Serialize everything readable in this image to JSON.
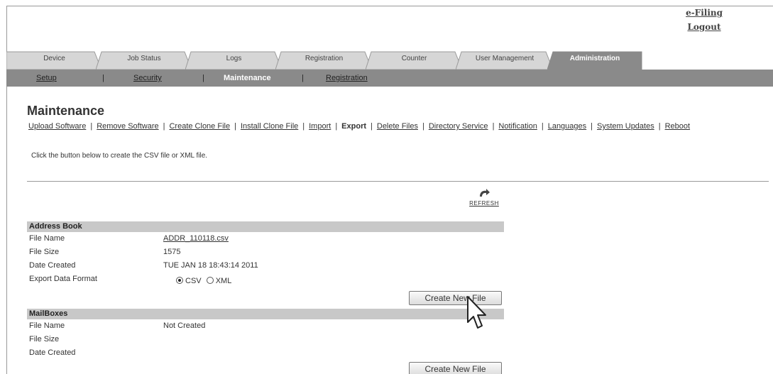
{
  "header": {
    "links": [
      "e-Filing",
      "Logout"
    ]
  },
  "tabs": [
    {
      "label": "Device",
      "active": false
    },
    {
      "label": "Job Status",
      "active": false
    },
    {
      "label": "Logs",
      "active": false
    },
    {
      "label": "Registration",
      "active": false
    },
    {
      "label": "Counter",
      "active": false
    },
    {
      "label": "User Management",
      "active": false
    },
    {
      "label": "Administration",
      "active": true
    }
  ],
  "subnav": {
    "items": [
      {
        "label": "Setup",
        "active": false
      },
      {
        "label": "Security",
        "active": false
      },
      {
        "label": "Maintenance",
        "active": true
      },
      {
        "label": "Registration",
        "active": false
      }
    ]
  },
  "page": {
    "title": "Maintenance",
    "links": [
      {
        "label": "Upload Software",
        "current": false
      },
      {
        "label": "Remove Software",
        "current": false
      },
      {
        "label": "Create Clone File",
        "current": false
      },
      {
        "label": "Install Clone File",
        "current": false
      },
      {
        "label": "Import",
        "current": false
      },
      {
        "label": "Export",
        "current": true
      },
      {
        "label": "Delete Files",
        "current": false
      },
      {
        "label": "Directory Service",
        "current": false
      },
      {
        "label": "Notification",
        "current": false
      },
      {
        "label": "Languages",
        "current": false
      },
      {
        "label": "System Updates",
        "current": false
      },
      {
        "label": "Reboot",
        "current": false
      }
    ],
    "intro": "Click the button below to create the CSV file or XML file.",
    "refresh_label": "REFRESH"
  },
  "address_book": {
    "heading": "Address Book",
    "file_name_label": "File Name",
    "file_name": "ADDR_110118.csv",
    "file_size_label": "File Size",
    "file_size": "1575",
    "date_created_label": "Date Created",
    "date_created": "TUE JAN 18 18:43:14 2011",
    "format_label": "Export Data Format",
    "format_csv": "CSV",
    "format_xml": "XML",
    "selected_format": "CSV",
    "button": "Create New File"
  },
  "mailboxes": {
    "heading": "MailBoxes",
    "file_name_label": "File Name",
    "file_name": "Not Created",
    "file_size_label": "File Size",
    "date_created_label": "Date Created",
    "button": "Create New File"
  },
  "colors": {
    "tab_inactive": "#d6d6d6",
    "tab_active": "#8a8a8a",
    "subnav_bg": "#8a8a8a",
    "section_header": "#c8c8c8"
  }
}
